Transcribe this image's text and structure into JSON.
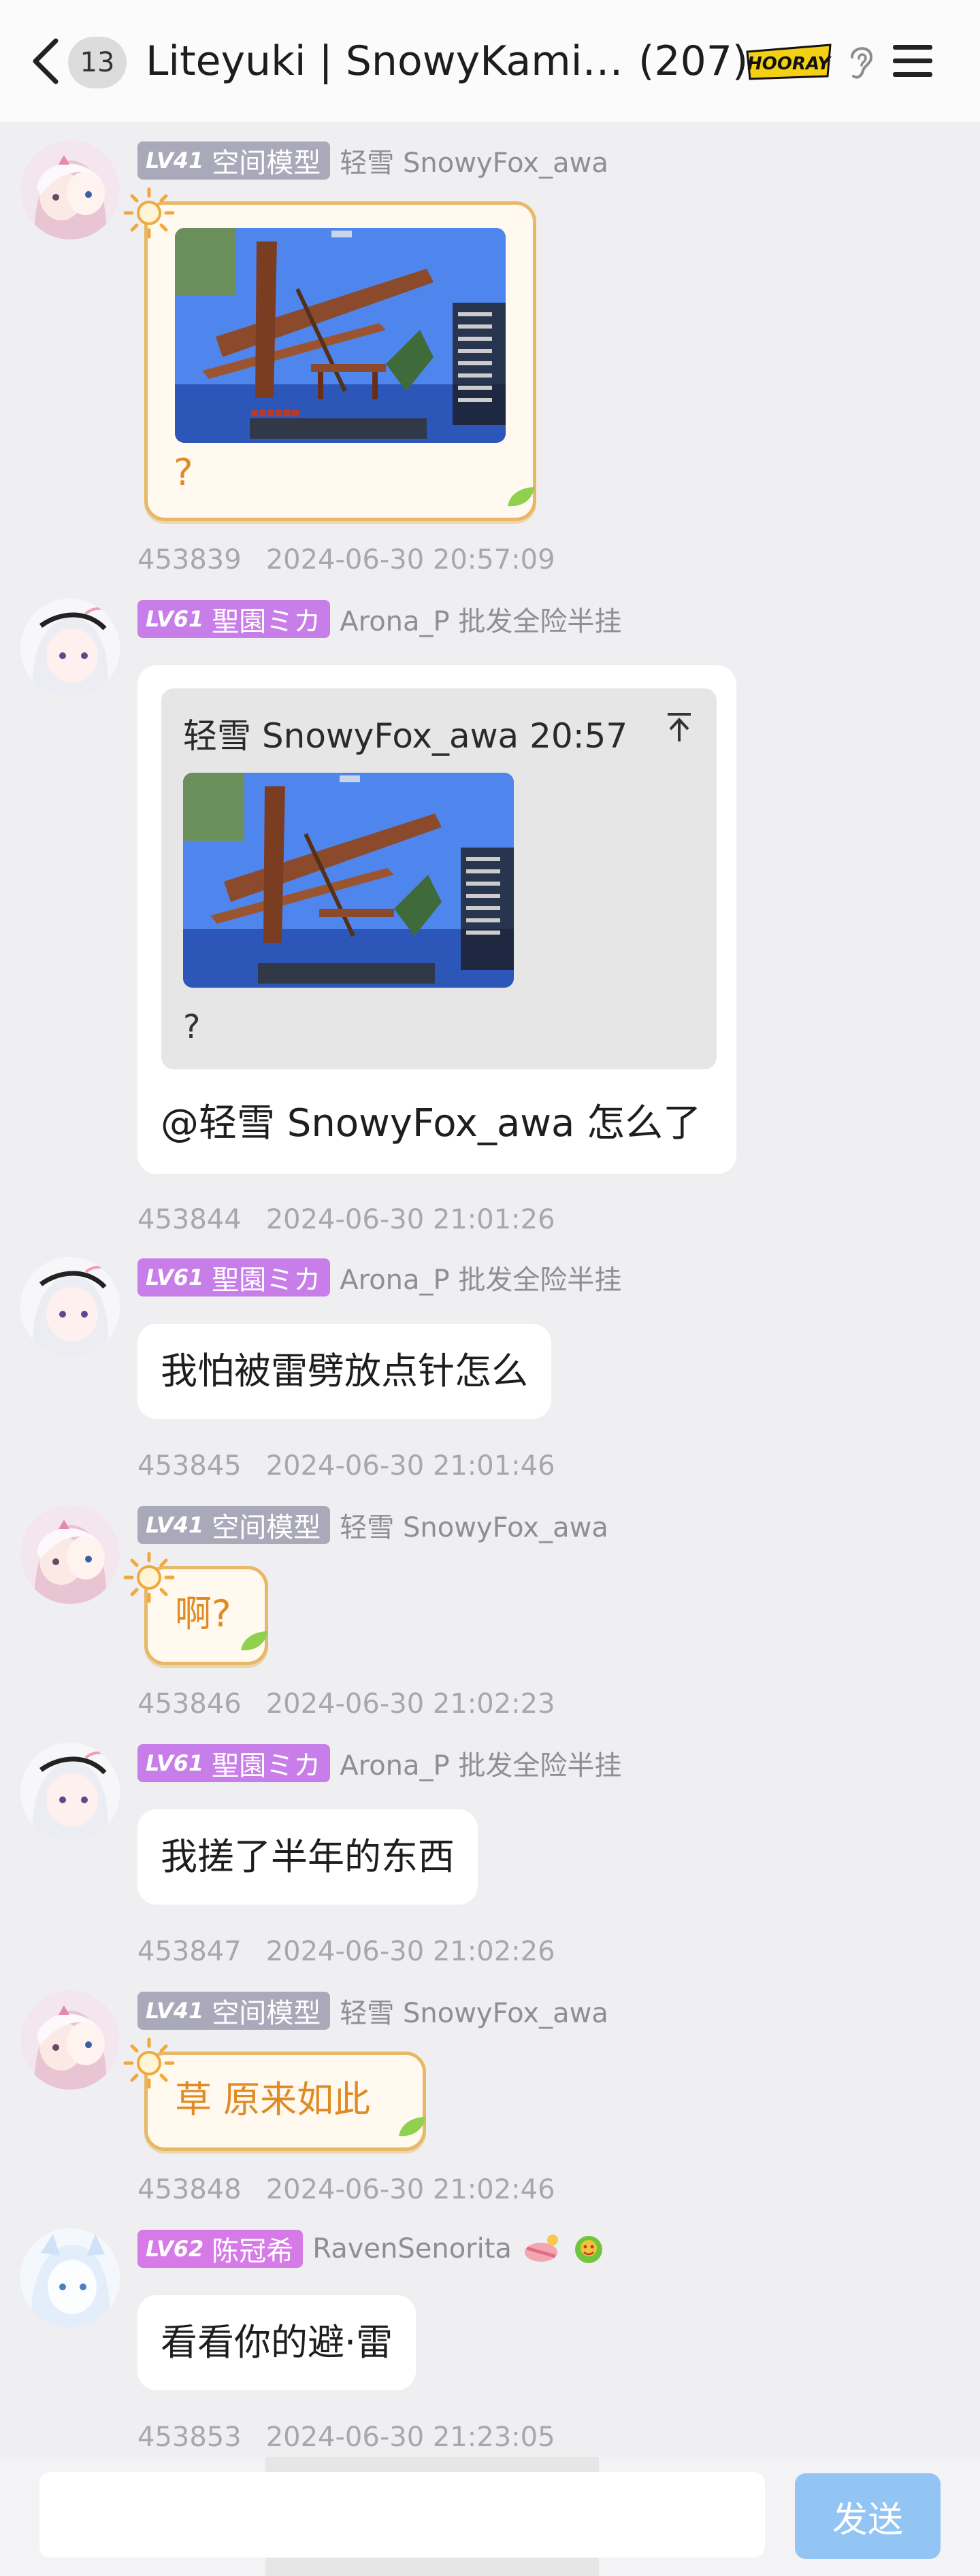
{
  "header": {
    "unread_count": "13",
    "title": "Liteyuki | SnowyKami |…",
    "member_count": "(207)",
    "badge_text": "HOORAY"
  },
  "messages": [
    {
      "level": "LV41",
      "title": "空间模型",
      "nickname": "轻雪 SnowyFox_awa",
      "caption": "?",
      "id": "453839",
      "time": "2024-06-30 20:57:09"
    },
    {
      "level": "LV61",
      "title": "聖園ミカ",
      "nickname": "Arona_P 批发全险半挂",
      "quote_author": "轻雪 SnowyFox_awa 20:57",
      "quote_text": "?",
      "text": "@轻雪 SnowyFox_awa 怎么了",
      "id": "453844",
      "time": "2024-06-30 21:01:26"
    },
    {
      "level": "LV61",
      "title": "聖園ミカ",
      "nickname": "Arona_P 批发全险半挂",
      "text": "我怕被雷劈放点针怎么",
      "id": "453845",
      "time": "2024-06-30 21:01:46"
    },
    {
      "level": "LV41",
      "title": "空间模型",
      "nickname": "轻雪 SnowyFox_awa",
      "text": "啊?",
      "id": "453846",
      "time": "2024-06-30 21:02:23"
    },
    {
      "level": "LV61",
      "title": "聖園ミカ",
      "nickname": "Arona_P 批发全险半挂",
      "text": "我搓了半年的东西",
      "id": "453847",
      "time": "2024-06-30 21:02:26"
    },
    {
      "level": "LV41",
      "title": "空间模型",
      "nickname": "轻雪 SnowyFox_awa",
      "text": "草 原来如此",
      "id": "453848",
      "time": "2024-06-30 21:02:46"
    },
    {
      "level": "LV62",
      "title": "陈冠希",
      "nickname": "RavenSenorita",
      "text": "看看你的避·雷",
      "id": "453853",
      "time": "2024-06-30 21:23:05"
    }
  ],
  "input": {
    "placeholder": "",
    "send_label": "发送"
  },
  "colors": {
    "accent_blue": "#93c5f4",
    "deco_text": "#e08a24",
    "deco_border": "#e8b867",
    "tag_gray": "#a9a9ba",
    "tag_purple": "#c87ee8"
  }
}
